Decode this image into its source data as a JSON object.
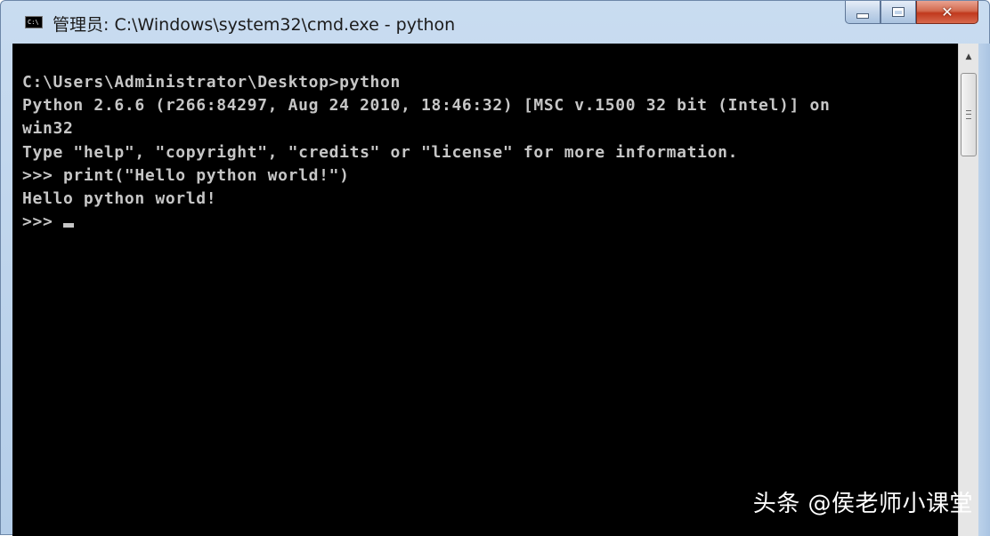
{
  "window": {
    "title": "管理员: C:\\Windows\\system32\\cmd.exe - python",
    "icon_text": "C:\\",
    "controls": {
      "minimize_icon": "minimize-icon",
      "maximize_icon": "maximize-icon",
      "close_icon": "close-icon",
      "close_glyph": "✕"
    },
    "colors": {
      "console_background": "#000000",
      "console_text": "#c6c6c6",
      "close_button": "#c0391d"
    }
  },
  "console": {
    "lines": [
      "C:\\Users\\Administrator\\Desktop>python",
      "Python 2.6.6 (r266:84297, Aug 24 2010, 18:46:32) [MSC v.1500 32 bit (Intel)] on",
      "win32",
      "Type \"help\", \"copyright\", \"credits\" or \"license\" for more information.",
      ">>> print(\"Hello python world!\")",
      "Hello python world!"
    ],
    "prompt": ">>> "
  },
  "scrollbar": {
    "up_arrow": "▲"
  },
  "watermark": {
    "text": "头条 @侯老师小课堂"
  }
}
